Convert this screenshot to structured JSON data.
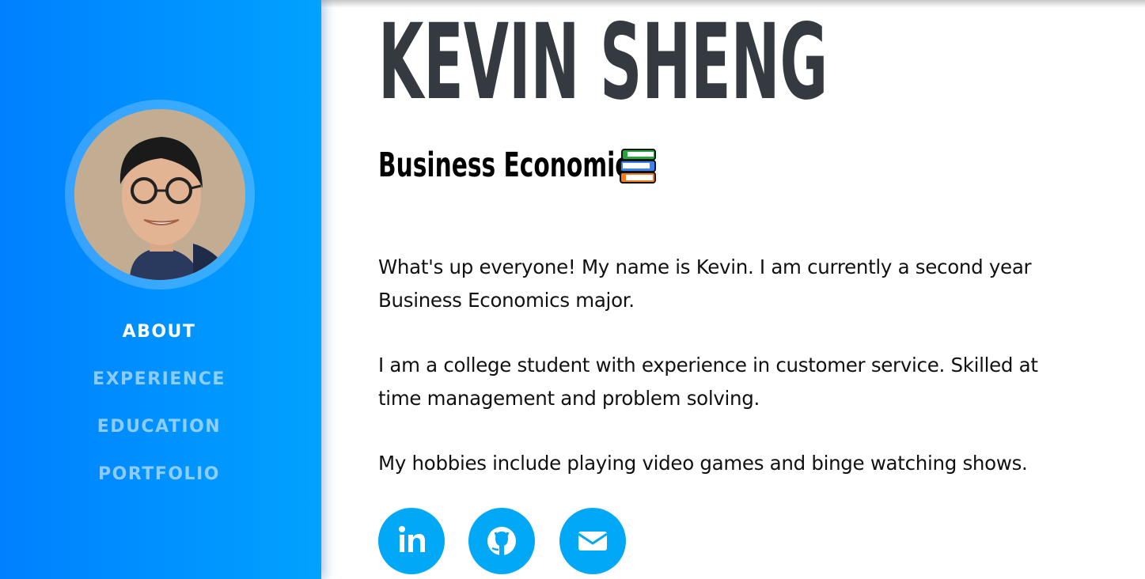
{
  "profile": {
    "name": "KEVIN SHENG",
    "subtitle": "Business Economics",
    "subtitle_icon": "books-emoji-icon",
    "avatar_icon": "profile-photo"
  },
  "nav": {
    "items": [
      {
        "label": "ABOUT",
        "active": true
      },
      {
        "label": "EXPERIENCE",
        "active": false
      },
      {
        "label": "EDUCATION",
        "active": false
      },
      {
        "label": "PORTFOLIO",
        "active": false
      }
    ]
  },
  "about": {
    "paragraphs": [
      "What's up everyone! My name is Kevin. I am currently a second year Business Economics major.",
      "I am a college student with experience in customer service. Skilled at time management and problem solving.",
      "My hobbies include playing video games and binge watching shows."
    ]
  },
  "social": {
    "links": [
      {
        "icon": "linkedin-icon"
      },
      {
        "icon": "github-icon"
      },
      {
        "icon": "envelope-icon"
      }
    ]
  },
  "colors": {
    "sidebar_start": "#0080ff",
    "sidebar_end": "#00a2ff",
    "social_bg": "#00a8f5",
    "heading": "#343a40"
  }
}
